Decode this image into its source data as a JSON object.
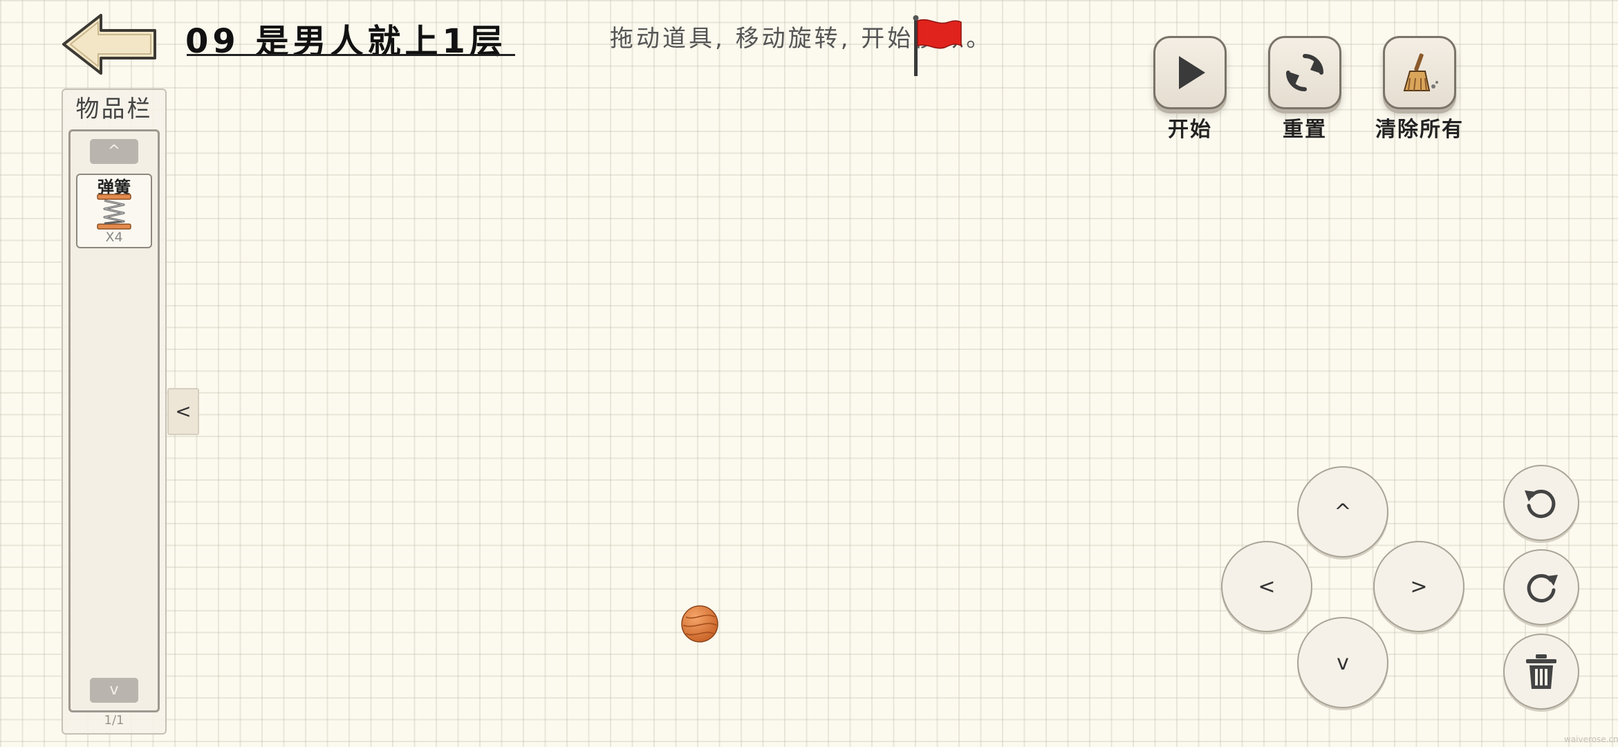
{
  "header": {
    "level_title": "09 是男人就上1层",
    "hint": "拖动道具, 移动旋转, 开始模拟。"
  },
  "toolbar": {
    "start_label": "开始",
    "reset_label": "重置",
    "clear_label": "清除所有"
  },
  "inventory": {
    "title": "物品栏",
    "scroll_up": "^",
    "scroll_down": "v",
    "items": [
      {
        "name": "弹簧",
        "count": "X4",
        "icon": "spring-icon"
      }
    ],
    "page": "1/1",
    "collapse": "<"
  },
  "controls": {
    "up": "^",
    "down": "v",
    "left": "<",
    "right": ">",
    "rotate_ccw_icon": "rotate-ccw-icon",
    "rotate_cw_icon": "rotate-cw-icon",
    "delete_icon": "trash-icon"
  },
  "watermark": "waiverose.cn",
  "colors": {
    "background": "#fcf9ee",
    "flag": "#e0231c",
    "ball": "#e07a3a"
  }
}
